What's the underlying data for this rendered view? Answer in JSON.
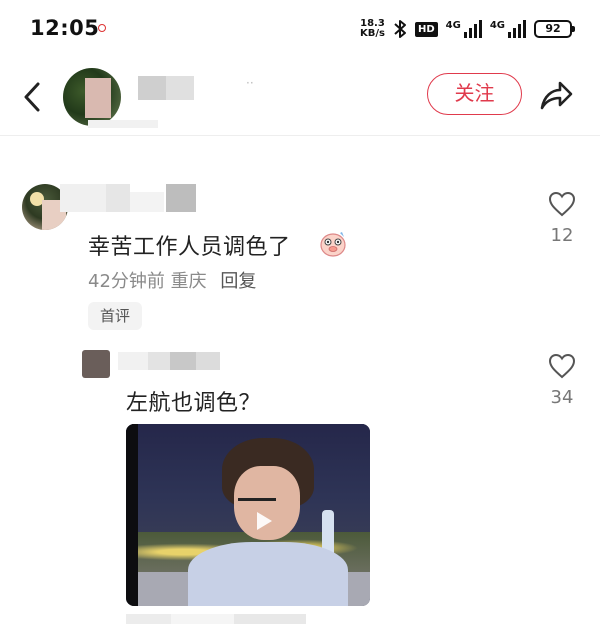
{
  "status_bar": {
    "time": "12:05",
    "speed_value": "18.3",
    "speed_unit": "KB/s",
    "hd_label": "HD",
    "network_1": "4G",
    "network_2": "4G",
    "battery": "92"
  },
  "header": {
    "follow_label": "关注",
    "icons": {
      "back": "chevron-left-icon",
      "share": "share-arrow-icon"
    }
  },
  "comments": [
    {
      "text": "幸苦工作人员调色了",
      "emoji": "blushing-pig-emoji",
      "time": "42分钟前",
      "location": "重庆",
      "reply_label": "回复",
      "badge": "首评",
      "likes": "12"
    },
    {
      "text": "左航也调色？",
      "likes": "34",
      "has_video": true
    }
  ],
  "colors": {
    "accent": "#e03a4c",
    "meta_text": "#8a8a8a",
    "like_count": "#777777"
  }
}
